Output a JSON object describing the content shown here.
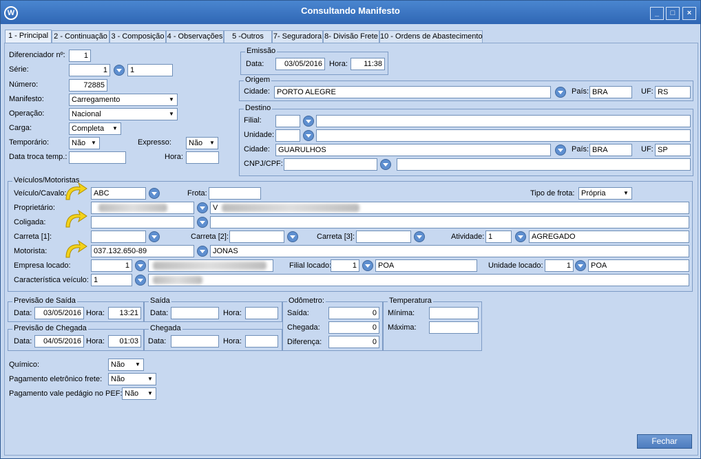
{
  "window": {
    "title": "Consultando Manifesto",
    "buttons": {
      "minimize": "_",
      "maximize": "□",
      "close": "×"
    }
  },
  "tabs": [
    "1 - Principal",
    "2 - Continuação",
    "3 - Composição",
    "4 - Observações",
    "5 -Outros",
    "7- Seguradora",
    "8- Divisão Frete",
    "10 - Ordens de Abastecimento"
  ],
  "main": {
    "diferenciador": {
      "label": "Diferenciador nº:",
      "value": "1"
    },
    "serie": {
      "label": "Série:",
      "value": "1",
      "value2": "1"
    },
    "numero": {
      "label": "Número:",
      "value": "72885"
    },
    "manifesto": {
      "label": "Manifesto:",
      "value": "Carregamento"
    },
    "operacao": {
      "label": "Operação:",
      "value": "Nacional"
    },
    "carga": {
      "label": "Carga:",
      "value": "Completa"
    },
    "temporario": {
      "label": "Temporário:",
      "value": "Não"
    },
    "expresso": {
      "label": "Expresso:",
      "value": "Não"
    },
    "data_troca": {
      "label": "Data troca temp.:",
      "value": ""
    },
    "hora_troca": {
      "label": "Hora:",
      "value": ""
    }
  },
  "emissao": {
    "title": "Emissão",
    "data_label": "Data:",
    "data": "03/05/2016",
    "hora_label": "Hora:",
    "hora": "11:38"
  },
  "origem": {
    "title": "Origem",
    "cidade_label": "Cidade:",
    "cidade": "PORTO ALEGRE",
    "pais_label": "País:",
    "pais": "BRA",
    "uf_label": "UF:",
    "uf": "RS"
  },
  "destino": {
    "title": "Destino",
    "filial_label": "Filial:",
    "filial": "",
    "filial_name": "",
    "unidade_label": "Unidade:",
    "unidade": "",
    "unidade_name": "",
    "cidade_label": "Cidade:",
    "cidade": "GUARULHOS",
    "pais_label": "País:",
    "pais": "BRA",
    "uf_label": "UF:",
    "uf": "SP",
    "cnpj_label": "CNPJ/CPF:",
    "cnpj": "",
    "cnpj_name": ""
  },
  "veiculos": {
    "title": "Veículos/Motoristas",
    "veiculo_label": "Veículo/Cavalo:",
    "veiculo": "ABC",
    "frota_label": "Frota:",
    "frota": "",
    "tipo_frota_label": "Tipo de frota:",
    "tipo_frota": "Própria",
    "proprietario_label": "Proprietário:",
    "proprietario_name": "V",
    "coligada_label": "Coligada:",
    "carreta1_label": "Carreta [1]:",
    "carreta2_label": "Carreta [2]:",
    "carreta3_label": "Carreta [3]:",
    "atividade_label": "Atividade:",
    "atividade": "1",
    "atividade_name": "AGREGADO",
    "motorista_label": "Motorista:",
    "motorista": "037.132.650-89",
    "motorista_name": "JONAS",
    "empresa_label": "Empresa locado:",
    "empresa": "1",
    "filial_locado_label": "Filial locado:",
    "filial_locado": "1",
    "filial_locado_name": "POA",
    "unidade_locado_label": "Unidade locado:",
    "unidade_locado": "1",
    "unidade_locado_name": "POA",
    "caracteristica_label": "Característica veículo:",
    "caracteristica": "1"
  },
  "prev_saida": {
    "title": "Previsão de Saída",
    "data_label": "Data:",
    "data": "03/05/2016",
    "hora_label": "Hora:",
    "hora": "13:21"
  },
  "saida": {
    "title": "Saída",
    "data_label": "Data:",
    "data": "",
    "hora_label": "Hora:",
    "hora": ""
  },
  "prev_chegada": {
    "title": "Previsão de Chegada",
    "data_label": "Data:",
    "data": "04/05/2016",
    "hora_label": "Hora:",
    "hora": "01:03"
  },
  "chegada": {
    "title": "Chegada",
    "data_label": "Data:",
    "data": "",
    "hora_label": "Hora:",
    "hora": ""
  },
  "odometro": {
    "title": "Odômetro:",
    "saida_label": "Saída:",
    "saida": "0",
    "chegada_label": "Chegada:",
    "chegada": "0",
    "diferenca_label": "Diferença:",
    "diferenca": "0"
  },
  "temperatura": {
    "title": "Temperatura",
    "minima_label": "Mínima:",
    "minima": "",
    "maxima_label": "Máxima:",
    "maxima": ""
  },
  "extras": {
    "quimico_label": "Químico:",
    "quimico": "Não",
    "pag_eletronico_label": "Pagamento eletrônico frete:",
    "pag_eletronico": "Não",
    "pag_pedagio_label": "Pagamento vale pedágio no PEF:",
    "pag_pedagio": "Não"
  },
  "footer": {
    "fechar": "Fechar"
  }
}
